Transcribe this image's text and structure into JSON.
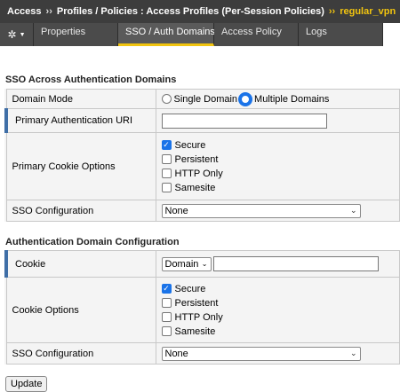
{
  "breadcrumb": {
    "items": [
      "Access",
      "Profiles / Policies : Access Profiles (Per-Session Policies)"
    ],
    "separator": "››",
    "current": "regular_vpn"
  },
  "tabs": {
    "gear_icon": "gear-icon",
    "items": [
      {
        "label": "Properties"
      },
      {
        "label": "SSO / Auth Domains"
      },
      {
        "label": "Access Policy"
      },
      {
        "label": "Logs"
      }
    ],
    "active_index": 1
  },
  "sso_section": {
    "title": "SSO Across Authentication Domains",
    "domain_mode": {
      "label": "Domain Mode",
      "options": [
        "Single Domain",
        "Multiple Domains"
      ],
      "selected": "Multiple Domains"
    },
    "primary_auth_uri": {
      "label": "Primary Authentication URI",
      "value": ""
    },
    "primary_cookie_options": {
      "label": "Primary Cookie Options",
      "options": [
        {
          "label": "Secure",
          "checked": true
        },
        {
          "label": "Persistent",
          "checked": false
        },
        {
          "label": "HTTP Only",
          "checked": false
        },
        {
          "label": "Samesite",
          "checked": false
        }
      ]
    },
    "sso_configuration": {
      "label": "SSO Configuration",
      "value": "None"
    }
  },
  "auth_domain_section": {
    "title": "Authentication Domain Configuration",
    "cookie": {
      "label": "Cookie",
      "type_value": "Domain",
      "value": ""
    },
    "cookie_options": {
      "label": "Cookie Options",
      "options": [
        {
          "label": "Secure",
          "checked": true
        },
        {
          "label": "Persistent",
          "checked": false
        },
        {
          "label": "HTTP Only",
          "checked": false
        },
        {
          "label": "Samesite",
          "checked": false
        }
      ]
    },
    "sso_configuration": {
      "label": "SSO Configuration",
      "value": "None"
    }
  },
  "update_button": "Update",
  "colors": {
    "accent": "#f1c40f",
    "header_bg": "#3d3d3d",
    "tab_bg": "#4b4b4b",
    "required_bar": "#3f6ea6",
    "radio_selected": "#1a73e8"
  }
}
